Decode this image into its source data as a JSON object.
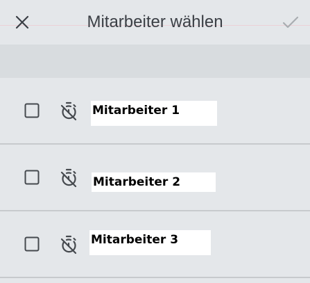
{
  "header": {
    "title": "Mitarbeiter wählen",
    "close_icon": "close-icon",
    "confirm_icon": "check-icon"
  },
  "employees": [
    {
      "name": "Mitarbeiter 1",
      "checked": false,
      "icon": "timer-off-icon"
    },
    {
      "name": "Mitarbeiter 2",
      "checked": false,
      "icon": "timer-off-icon"
    },
    {
      "name": "Mitarbeiter 3",
      "checked": false,
      "icon": "timer-off-icon"
    }
  ],
  "colors": {
    "background": "#e4e7ea",
    "band": "#d8dcdf",
    "title_text": "#3b3f45",
    "icon_dark": "#45494e",
    "icon_disabled": "#a9adb1",
    "divider": "#c7cacd"
  }
}
